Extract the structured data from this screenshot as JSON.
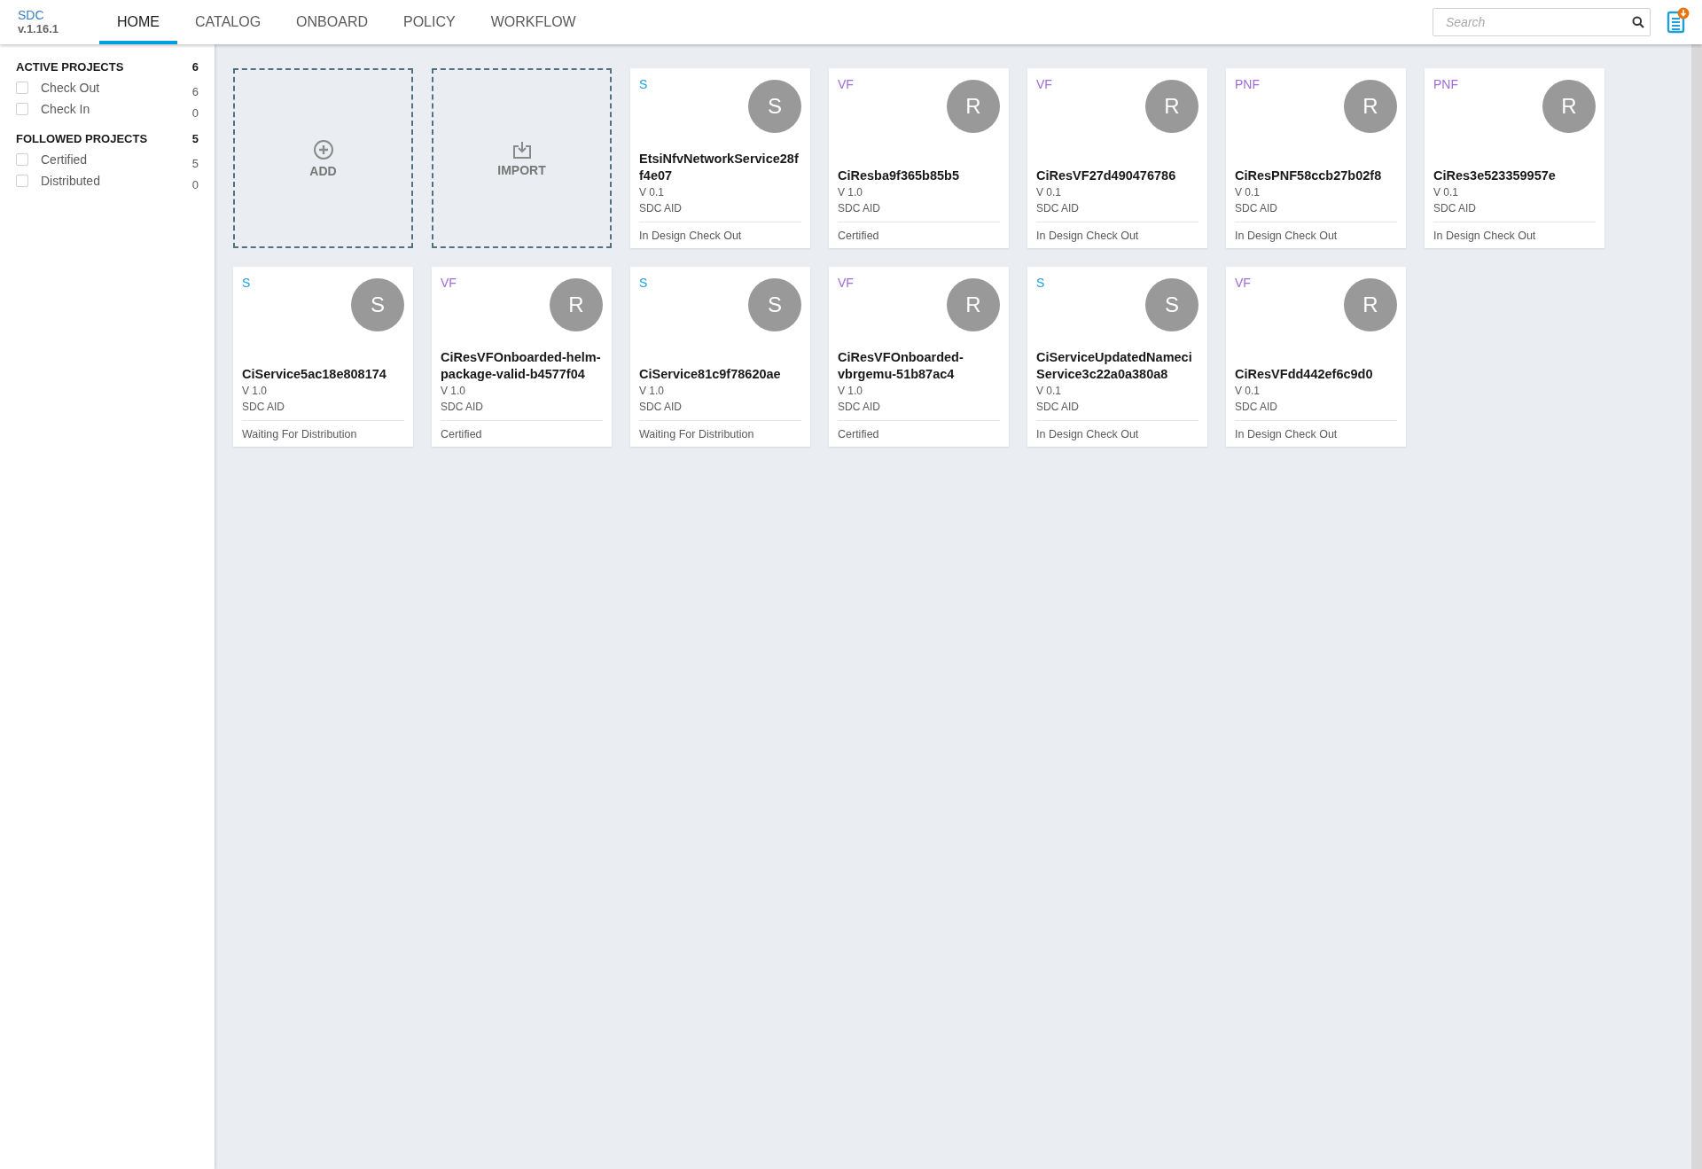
{
  "app": {
    "name": "SDC",
    "version": "v.1.16.1"
  },
  "tabs": [
    {
      "label": "HOME",
      "selected": true
    },
    {
      "label": "CATALOG",
      "selected": false
    },
    {
      "label": "ONBOARD",
      "selected": false
    },
    {
      "label": "POLICY",
      "selected": false
    },
    {
      "label": "WORKFLOW",
      "selected": false
    }
  ],
  "search": {
    "placeholder": "Search"
  },
  "sidebar": {
    "sections": [
      {
        "title": "ACTIVE PROJECTS",
        "count": "6",
        "items": [
          {
            "label": "Check Out",
            "count": "6",
            "checked": false
          },
          {
            "label": "Check In",
            "count": "0",
            "checked": false
          }
        ]
      },
      {
        "title": "FOLLOWED PROJECTS",
        "count": "5",
        "items": [
          {
            "label": "Certified",
            "count": "5",
            "checked": false
          },
          {
            "label": "Distributed",
            "count": "0",
            "checked": false
          }
        ]
      }
    ]
  },
  "actions": [
    {
      "kind": "add",
      "label": "ADD"
    },
    {
      "kind": "import",
      "label": "IMPORT"
    }
  ],
  "cards": [
    {
      "type": "S",
      "color": "#1ea0e0",
      "avatar": "S",
      "name": "EtsiNfvNetworkService28ff4e07",
      "version": "V 0.1",
      "owner": "SDC AID",
      "status": "In Design Check Out"
    },
    {
      "type": "VF",
      "color": "#9d6cd8",
      "avatar": "R",
      "name": "CiResba9f365b85b5",
      "version": "V 1.0",
      "owner": "SDC AID",
      "status": "Certified"
    },
    {
      "type": "VF",
      "color": "#9d6cd8",
      "avatar": "R",
      "name": "CiResVF27d490476786",
      "version": "V 0.1",
      "owner": "SDC AID",
      "status": "In Design Check Out"
    },
    {
      "type": "PNF",
      "color": "#9d6cd8",
      "avatar": "R",
      "name": "CiResPNF58ccb27b02f8",
      "version": "V 0.1",
      "owner": "SDC AID",
      "status": "In Design Check Out"
    },
    {
      "type": "PNF",
      "color": "#9d6cd8",
      "avatar": "R",
      "name": "CiRes3e523359957e",
      "version": "V 0.1",
      "owner": "SDC AID",
      "status": "In Design Check Out"
    },
    {
      "type": "S",
      "color": "#1ea0e0",
      "avatar": "S",
      "name": "CiService5ac18e808174",
      "version": "V 1.0",
      "owner": "SDC AID",
      "status": "Waiting For Distribution"
    },
    {
      "type": "VF",
      "color": "#9d6cd8",
      "avatar": "R",
      "name": "CiResVFOnboarded-helm-package-valid-b4577f04",
      "version": "V 1.0",
      "owner": "SDC AID",
      "status": "Certified"
    },
    {
      "type": "S",
      "color": "#1ea0e0",
      "avatar": "S",
      "name": "CiService81c9f78620ae",
      "version": "V 1.0",
      "owner": "SDC AID",
      "status": "Waiting For Distribution"
    },
    {
      "type": "VF",
      "color": "#9d6cd8",
      "avatar": "R",
      "name": "CiResVFOnboarded-vbrgemu-51b87ac4",
      "version": "V 1.0",
      "owner": "SDC AID",
      "status": "Certified"
    },
    {
      "type": "S",
      "color": "#1ea0e0",
      "avatar": "S",
      "name": "CiServiceUpdatedNameciService3c22a0a380a8",
      "version": "V 0.1",
      "owner": "SDC AID",
      "status": "In Design Check Out"
    },
    {
      "type": "VF",
      "color": "#9d6cd8",
      "avatar": "R",
      "name": "CiResVFdd442ef6c9d0",
      "version": "V 0.1",
      "owner": "SDC AID",
      "status": "In Design Check Out"
    }
  ]
}
